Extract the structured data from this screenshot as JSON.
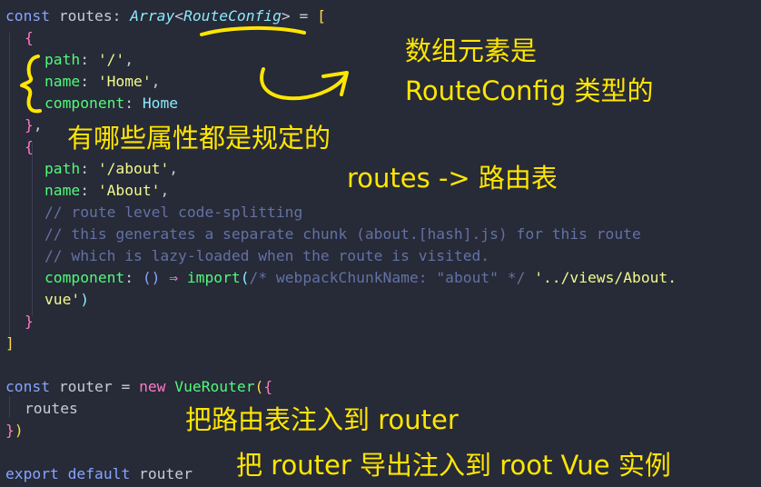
{
  "code": {
    "l1": {
      "kw": "const",
      "name": " routes",
      "colon": ": ",
      "type": "Array",
      "lt": "<",
      "generic": "RouteConfig",
      "gt": ">",
      "eq": " = ",
      "bracket": "["
    },
    "l2": {
      "brace": "{"
    },
    "l3": {
      "prop": "path",
      "colon": ": ",
      "val": "'/'",
      "comma": ","
    },
    "l4": {
      "prop": "name",
      "colon": ": ",
      "val": "'Home'",
      "comma": ","
    },
    "l5": {
      "prop": "component",
      "colon": ": ",
      "val": "Home"
    },
    "l6": {
      "brace": "}",
      "comma": ","
    },
    "l7": {
      "brace": "{"
    },
    "l8": {
      "prop": "path",
      "colon": ": ",
      "val": "'/about'",
      "comma": ","
    },
    "l9": {
      "prop": "name",
      "colon": ": ",
      "val": "'About'",
      "comma": ","
    },
    "l10": "// route level code-splitting",
    "l11": "// this generates a separate chunk (about.[hash].js) for this route",
    "l12": "// which is lazy-loaded when the route is visited.",
    "l13": {
      "prop": "component",
      "colon": ": ",
      "parens": "()",
      "arrow": " ⇒ ",
      "fn": "import",
      "open": "(",
      "comment": "/* webpackChunkName: \"about\" */",
      "str": " '../views/About."
    },
    "l14": {
      "str": "vue'",
      "close": ")"
    },
    "l15": {
      "brace": "}"
    },
    "l16": {
      "bracket": "]"
    },
    "l18": {
      "kw": "const",
      "name": " router",
      "eq": " = ",
      "new": "new",
      "cls": " VueRouter",
      "open": "(",
      "brace": "{"
    },
    "l19": {
      "ident": "routes"
    },
    "l20": {
      "brace": "}",
      "close": ")"
    },
    "l22": {
      "kw": "export",
      "kw2": " default",
      "ident": " router"
    }
  },
  "annotations": {
    "array_elements": "数组元素是",
    "routeconfig_type": "RouteConfig 类型的",
    "properties": "有哪些属性都是规定的",
    "routes_table": "routes -> 路由表",
    "inject_router": "把路由表注入到 router",
    "export_router": "把 router 导出注入到 root Vue 实例"
  },
  "colors": {
    "background": "#272a37",
    "annotation": "#ffe600",
    "keyword": "#ff79c6",
    "type": "#8be9fd",
    "property": "#50fa7b",
    "string": "#f1fa8c",
    "comment": "#6272a4",
    "text": "#c8cbd6"
  }
}
